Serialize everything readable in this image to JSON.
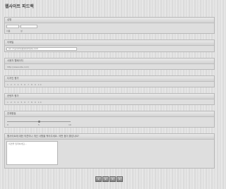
{
  "page": {
    "title": "웹사이트 피드백"
  },
  "sections": {
    "name": {
      "label": "성명",
      "first_label": "이름",
      "last_label": "성"
    },
    "email": {
      "label": "이메일",
      "value": "ex: myname@example.com"
    },
    "url": {
      "label": "사용자 웹페이지",
      "placeholder": "http://www.site.com/"
    },
    "design": {
      "label": "디자인 평가",
      "scale": "1 2 3 4 5 6 7 8 9 10"
    },
    "content": {
      "label": "컨텐츠 평가",
      "scale": "1 2 3 4 5 6 7 8 9 10"
    },
    "rating": {
      "label": "전체평점",
      "min": "0",
      "mid": "5",
      "max": "10"
    },
    "comments": {
      "label": "웹사이트에 대한 의견이나 개선 사항을 적어주세요. 어떤 점이 좋았나요?",
      "placeholder": "의견을 입력하세요..."
    }
  },
  "buttons": [
    "1",
    "2",
    "3",
    "4"
  ]
}
